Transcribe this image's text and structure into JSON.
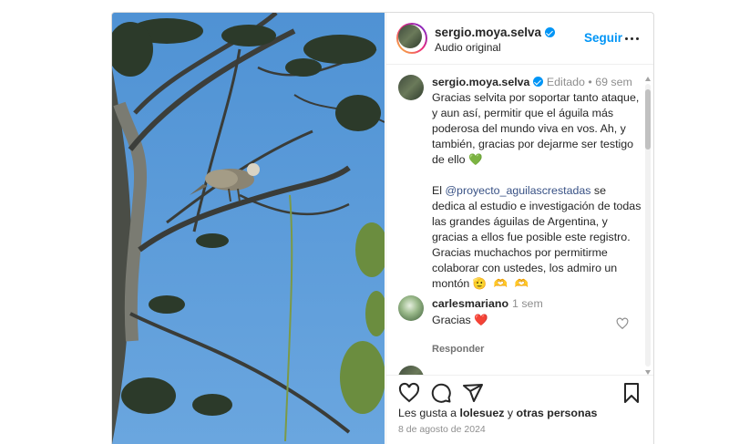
{
  "post": {
    "header": {
      "username": "sergio.moya.selva",
      "subtitle": "Audio original",
      "follow_label": "Seguir",
      "more_icon": "more-horizontal-icon"
    },
    "caption": {
      "username": "sergio.moya.selva",
      "edited_label": "Editado",
      "separator": "•",
      "age": "69 sem",
      "paragraph1": "Gracias selvita por soportar tanto ataque, y aun así, permitir que el águila más poderosa del mundo viva en vos. Ah, y también, gracias por dejarme ser testigo de ello",
      "paragraph1_emoji": "💚",
      "paragraph2_prefix": "El ",
      "mention": "@proyecto_aguilascrestadas",
      "paragraph2_suffix": " se dedica al estudio e investigación de todas las grandes águilas de Argentina, y gracias a ellos fue posible este registro. Gracias muchachos por permitirme colaborar con ustedes, los admiro un montón",
      "paragraph2_emojis": "🫡 🫶 🫶"
    },
    "comments": [
      {
        "username": "carlesmariano",
        "age": "1 sem",
        "text": "Gracias",
        "emoji": "❤️",
        "reply_label": "Responder"
      }
    ],
    "actions": {
      "like_icon": "heart-icon",
      "comment_icon": "comment-icon",
      "share_icon": "send-icon",
      "save_icon": "bookmark-icon"
    },
    "likes": {
      "prefix": "Les gusta a ",
      "user": "lolesuez",
      "middle": " y ",
      "others": "otras personas"
    },
    "date": "8 de agosto de 2024"
  },
  "colors": {
    "accent": "#0095f6",
    "sky": "#5a9ad6",
    "border": "#dbdbdb",
    "muted": "#8e8e8e"
  }
}
